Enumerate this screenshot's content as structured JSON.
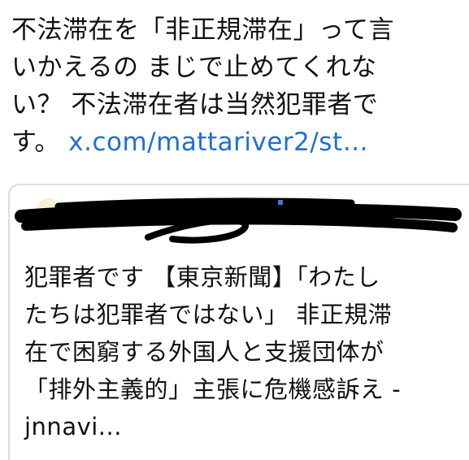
{
  "tweet": {
    "text_line1": "不法滞在を「非正規滞在」って言",
    "text_line2": "いかえるの まじで止めてくれな",
    "text_line3": "い？ 不法滞在者は当然犯罪者で",
    "text_line4_prefix": "す。",
    "link": "x.com/mattariver2/st…",
    "link_color": "#1d6fd6"
  },
  "quoted_card": {
    "header_redacted": true,
    "body_line1": "犯罪者です 【東京新聞】「わたし",
    "body_line2": "たちは犯罪者ではない」 非正規滞",
    "body_line3": "在で困窮する外国人と支援団体が",
    "body_line4": "「排外主義的」主張に危機感訴え -",
    "body_line5": "jnnavi..."
  }
}
